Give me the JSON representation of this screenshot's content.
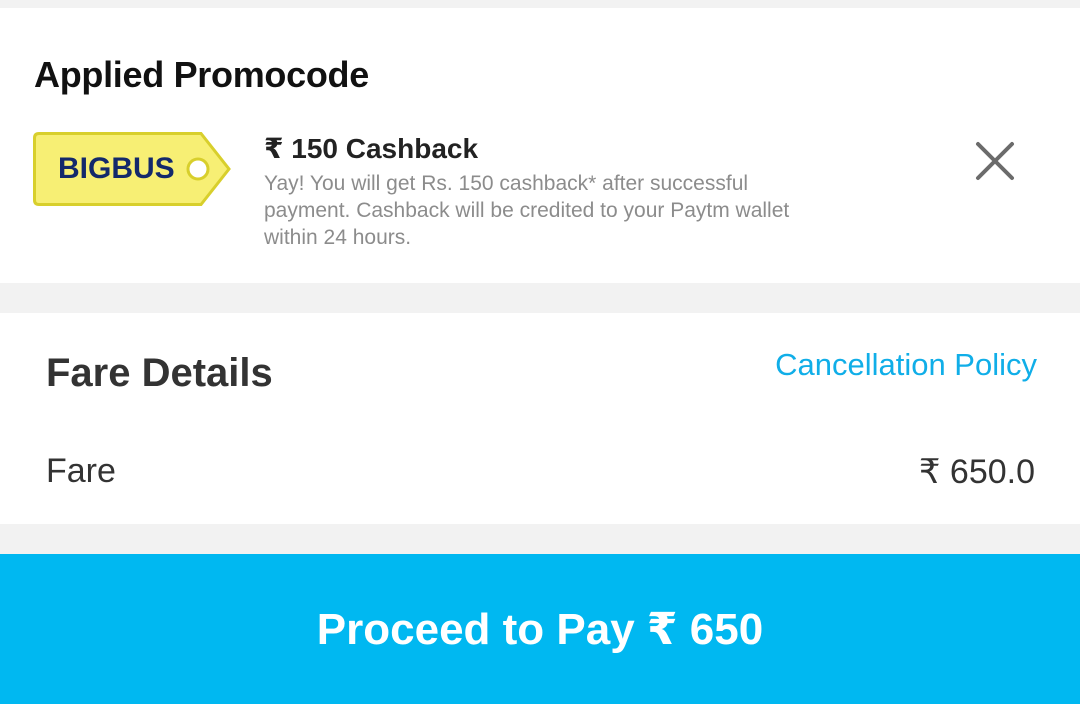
{
  "promo": {
    "heading": "Applied Promocode",
    "code": "BIGBUS",
    "cashback_title": "₹ 150 Cashback",
    "cashback_description": "Yay! You will get Rs. 150 cashback* after successful payment. Cashback will be credited to your Paytm wallet within 24 hours.",
    "remove_icon": "close-icon",
    "tag_color": "#f7ef74",
    "tag_border_color": "#d8cf2c",
    "code_color": "#13296b"
  },
  "fare": {
    "heading": "Fare Details",
    "cancellation_link": "Cancellation Policy",
    "fare_label": "Fare",
    "fare_value": "₹ 650.0"
  },
  "payment": {
    "button_label": "Proceed to Pay ₹ 650",
    "button_color": "#00b8f1"
  },
  "colors": {
    "link": "#10aee8",
    "background": "#f2f2f2"
  }
}
